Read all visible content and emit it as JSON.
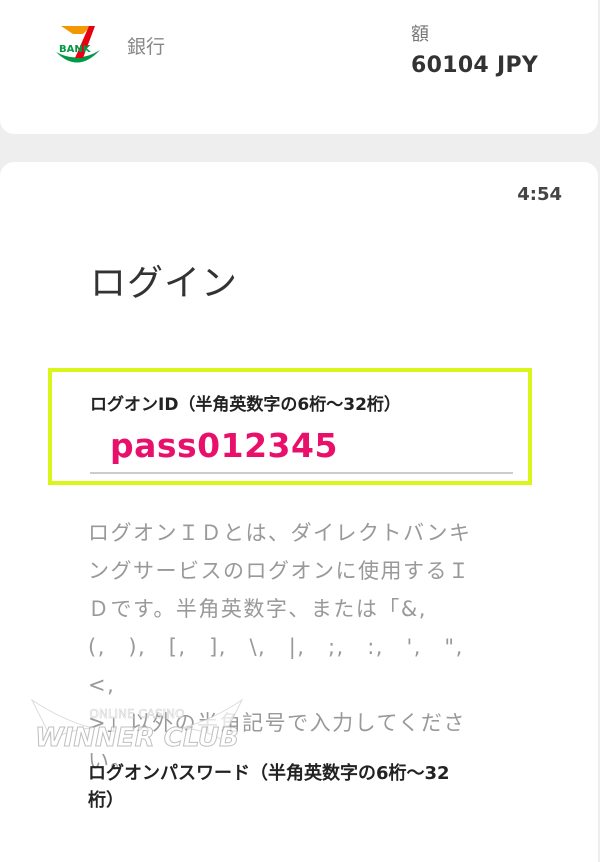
{
  "header": {
    "bank_label": "銀行",
    "amount_label": "額",
    "amount_value": "60104 JPY",
    "logo_text": "BANK"
  },
  "login": {
    "timer": "4:54",
    "title": "ログイン",
    "logon_id_label": "ログオンID（半角英数字の6桁～32桁）",
    "logon_id_value": "pass012345",
    "help_text": "ログオンＩＤとは、ダイレクトバンキ\nングサービスのログオンに使用するＩ\nＤです。半角英数字、または「&,\n(,　),　[,　],　\\,　|,　;,　:,　',　\",　<,\n>」以外の半角記号で入力してくださ\nい。",
    "password_label": "ログオンパスワード（半角英数字の6桁～32\n桁）"
  },
  "watermark": {
    "line1": "ONLINE CASINO",
    "line2": "WINNER CLUB"
  },
  "colors": {
    "highlight_border": "#d9f51a",
    "entered_value": "#e8106b",
    "logo_red": "#e60012",
    "logo_green": "#009a44",
    "logo_orange": "#f39800"
  }
}
